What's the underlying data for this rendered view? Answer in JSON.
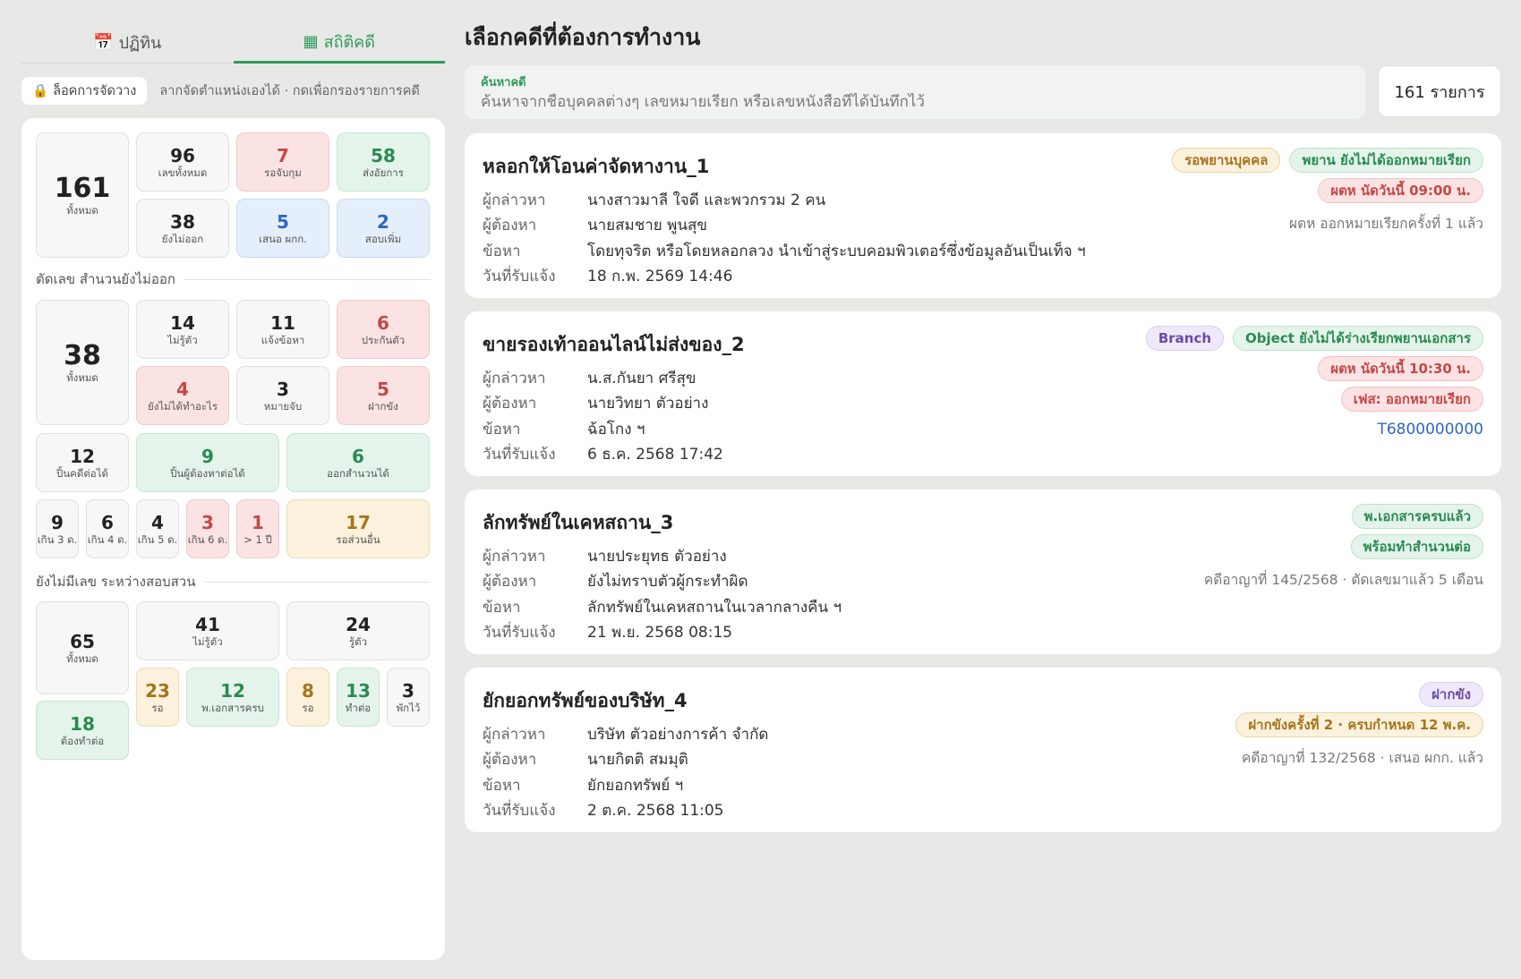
{
  "tabs": [
    {
      "icon": "📅",
      "label": "ปฏิทิน",
      "active": false
    },
    {
      "icon": "▦",
      "label": "สถิติคดี",
      "active": true
    }
  ],
  "lock": {
    "icon": "🔒",
    "label": "ล็อคการจัดวาง",
    "hint": "ลากจัดตำแหน่งเองได้ · กดเพื่อกรองรายการคดี"
  },
  "stats": {
    "total": {
      "n": "161",
      "l": "ทั้งหมด"
    },
    "case_numbers": {
      "n": "96",
      "l": "เลขทั้งหมด"
    },
    "arrest_pending": {
      "n": "7",
      "l": "รอจับกุม"
    },
    "sent_prosecutor": {
      "n": "58",
      "l": "ส่งอัยการ"
    },
    "not_issued": {
      "n": "38",
      "l": "ยังไม่ออก"
    },
    "proposed": {
      "n": "5",
      "l": "เสนอ ผกก."
    },
    "more_inquiry": {
      "n": "2",
      "l": "สอบเพิ่ม"
    },
    "section2_title": "ตัดเลข สำนวนยังไม่ออก",
    "s2_total": {
      "n": "38",
      "l": "ทั้งหมด"
    },
    "unknown": {
      "n": "14",
      "l": "ไม่รู้ตัว"
    },
    "notified": {
      "n": "11",
      "l": "แจ้งข้อหา"
    },
    "bail": {
      "n": "6",
      "l": "ประกันตัว"
    },
    "nothing_done": {
      "n": "4",
      "l": "ยังไม่ได้ทำอะไร"
    },
    "warrant": {
      "n": "3",
      "l": "หมายจับ"
    },
    "detention": {
      "n": "5",
      "l": "ฝากขัง"
    },
    "closeable": {
      "n": "12",
      "l": "ปิ้นคดีต่อได้"
    },
    "suspect_continue": {
      "n": "9",
      "l": "ปิ้นผู้ต้องหาต่อได้"
    },
    "file_ready": {
      "n": "6",
      "l": "ออกสำนวนได้"
    },
    "over3": {
      "n": "9",
      "l": "เกิน 3 ด."
    },
    "over4": {
      "n": "6",
      "l": "เกิน 4 ด."
    },
    "over5": {
      "n": "4",
      "l": "เกิน 5 ด."
    },
    "over6": {
      "n": "3",
      "l": "เกิน 6 ด."
    },
    "over1y": {
      "n": "1",
      "l": "> 1 ปี"
    },
    "waiting_other": {
      "n": "17",
      "l": "รอส่วนอื่น"
    },
    "section3_title": "ยังไม่มีเลข ระหว่างสอบสวน",
    "s3_total": {
      "n": "65",
      "l": "ทั้งหมด"
    },
    "s3_unknown": {
      "n": "41",
      "l": "ไม่รู้ตัว"
    },
    "s3_known": {
      "n": "24",
      "l": "รู้ตัว"
    },
    "wait_a": {
      "n": "23",
      "l": "รอ"
    },
    "docs_complete": {
      "n": "12",
      "l": "พ.เอกสารครบ"
    },
    "wait_b": {
      "n": "8",
      "l": "รอ"
    },
    "continue": {
      "n": "13",
      "l": "ทำต่อ"
    },
    "paused": {
      "n": "3",
      "l": "พักไว้"
    },
    "todo": {
      "n": "18",
      "l": "ต้องทำต่อ"
    }
  },
  "main": {
    "title": "เลือกคดีที่ต้องการทำงาน",
    "search_label": "ค้นหาคดี",
    "search_placeholder": "ค้นหาจากชื่อบุคคลต่างๆ เลขหมายเรียก หรือเลขหนังสือที่ได้บันทึกไว้",
    "count": "161 รายการ",
    "field_labels": {
      "plaintiff": "ผู้กล่าวหา",
      "accused": "ผู้ต้องหา",
      "charge": "ข้อหา",
      "received": "วันที่รับแจ้ง"
    }
  },
  "cases": [
    {
      "title": "หลอกให้โอนค่าจัดหางาน_1",
      "plaintiff": "นางสาวมาลี ใจดี และพวกรวม 2 คน",
      "accused": "นายสมชาย พูนสุข",
      "charge": "โดยทุจริต หรือโดยหลอกลวง นำเข้าสู่ระบบคอมพิวเตอร์ซึ่งข้อมูลอันเป็นเท็จ ฯ",
      "received": "18 ก.พ. 2569 14:46",
      "badge1": "รอพยานบุคคล",
      "badge2": "พยาน ยังไม่ได้ออกหมายเรียก",
      "badge3": "ผตห นัดวันนี้ 09:00 น.",
      "note": "ผตห ออกหมายเรียกครั้งที่ 1 แล้ว"
    },
    {
      "title": "ขายรองเท้าออนไลน์ไม่ส่งของ_2",
      "plaintiff": "น.ส.กันยา ศรีสุข",
      "accused": "นายวิทยา ตัวอย่าง",
      "charge": "ฉ้อโกง ฯ",
      "received": "6 ธ.ค. 2568 17:42",
      "badge1": "Branch",
      "badge2": "Object ยังไม่ได้ร่างเรียกพยานเอกสาร",
      "badge3": "ผตห นัดวันนี้ 10:30 น.",
      "badge4": "เฟส: ออกหมายเรียก",
      "link": "T6800000000"
    },
    {
      "title": "ลักทรัพย์ในเคหสถาน_3",
      "plaintiff": "นายประยุทธ ตัวอย่าง",
      "accused": "ยังไม่ทราบตัวผู้กระทำผิด",
      "charge": "ลักทรัพย์ในเคหสถานในเวลากลางคืน ฯ",
      "received": "21 พ.ย. 2568 08:15",
      "badge1": "พ.เอกสารครบแล้ว",
      "badge2": "พร้อมทำสำนวนต่อ",
      "note": "คดีอาญาที่ 145/2568 · ตัดเลขมาแล้ว 5 เดือน"
    },
    {
      "title": "ยักยอกทรัพย์ของบริษัท_4",
      "plaintiff": "บริษัท ตัวอย่างการค้า จำกัด",
      "accused": "นายกิตติ สมมุติ",
      "charge": "ยักยอกทรัพย์ ฯ",
      "received": "2 ต.ค. 2568 11:05",
      "badge1": "ฝากขัง",
      "badge2": "ฝากขังครั้งที่ 2 · ครบกำหนด 12 พ.ค.",
      "note": "คดีอาญาที่ 132/2568 · เสนอ ผกก. แล้ว"
    }
  ]
}
